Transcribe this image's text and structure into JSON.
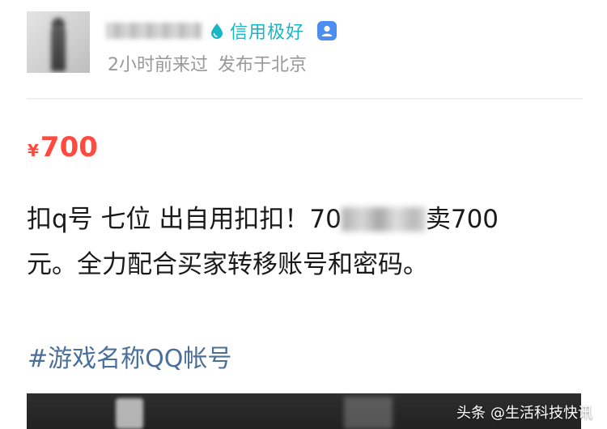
{
  "seller": {
    "avatar_icon": "user-avatar",
    "credit_icon": "water-drop-icon",
    "credit_label": "信用极好",
    "verified_icon": "verified-badge-icon",
    "last_seen": "2小时前来过",
    "location": "发布于北京"
  },
  "listing": {
    "price_symbol": "¥",
    "price": "700",
    "description_line1_prefix": "扣q号 七位 出自用扣扣！70",
    "description_line1_suffix": "卖700",
    "description_line2": "元。全力配合买家转移账号和密码。",
    "hashtag": "#游戏名称QQ帐号"
  },
  "watermark": {
    "source": "头条",
    "account": "@生活科技快讯"
  },
  "colors": {
    "credit_accent": "#19b6c4",
    "price": "#ff4a3d",
    "hashtag": "#4a6f9c",
    "meta_text": "#999999"
  }
}
